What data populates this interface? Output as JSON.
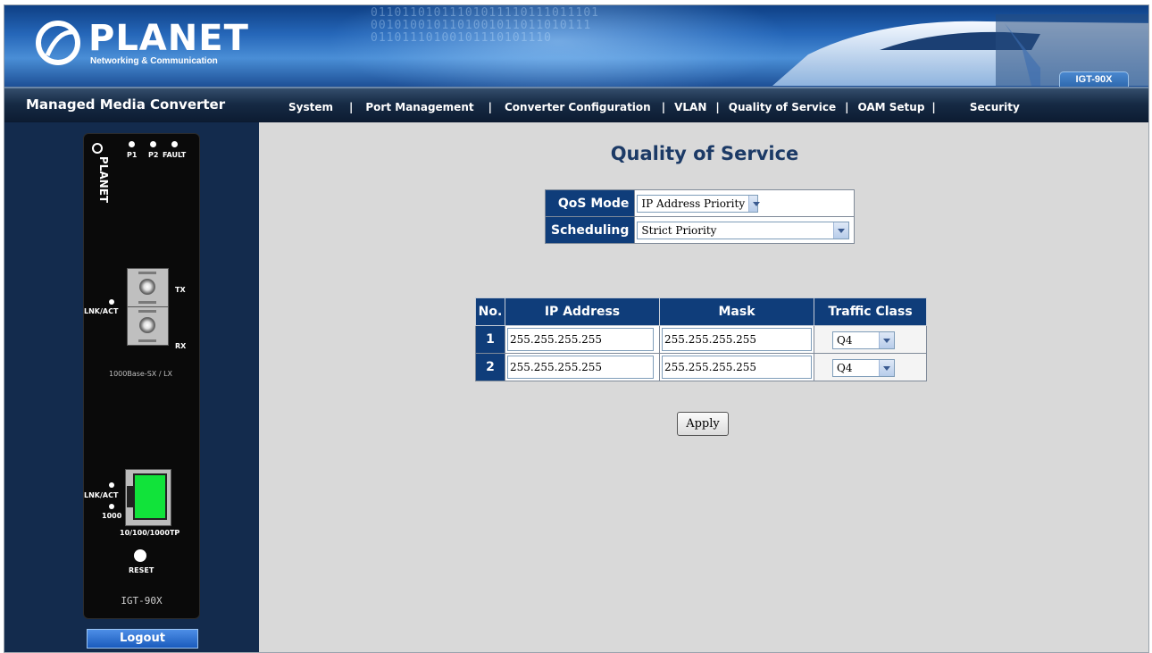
{
  "header": {
    "logo_text": "PLANET",
    "logo_subtitle": "Networking & Communication",
    "model_tab": "IGT-90X",
    "brand": "Managed Media Converter"
  },
  "nav": {
    "items": [
      "System",
      "Port Management",
      "Converter Configuration",
      "VLAN",
      "Quality of Service",
      "OAM Setup",
      "Security"
    ],
    "separator": "|"
  },
  "device": {
    "led_labels": [
      "P1",
      "P2",
      "FAULT"
    ],
    "fiber_tx": "TX",
    "fiber_rx": "RX",
    "lnk_act_fiber": "LNK/ACT",
    "fiber_type": "1000Base-SX / LX",
    "lnk_act_copper": "LNK/ACT",
    "speed_led": "1000",
    "copper_type": "10/100/1000TP",
    "reset": "RESET",
    "model": "IGT-90X",
    "logo_text": "PLANET"
  },
  "logout_label": "Logout",
  "page": {
    "title": "Quality of Service",
    "qos_mode_label": "QoS Mode",
    "qos_mode_value": "IP Address Priority",
    "scheduling_label": "Scheduling",
    "scheduling_value": "Strict Priority",
    "table_headers": [
      "No.",
      "IP Address",
      "Mask",
      "Traffic Class"
    ],
    "rows": [
      {
        "no": "1",
        "ip": "255.255.255.255",
        "mask": "255.255.255.255",
        "traffic_class": "Q4"
      },
      {
        "no": "2",
        "ip": "255.255.255.255",
        "mask": "255.255.255.255",
        "traffic_class": "Q4"
      }
    ],
    "apply_label": "Apply"
  },
  "colors": {
    "header_cell": "#0f3d7a",
    "title": "#1c3a66",
    "sidebar": "#132b4d",
    "content_bg": "#d9d9d9",
    "rj45_green": "#11e33a"
  }
}
